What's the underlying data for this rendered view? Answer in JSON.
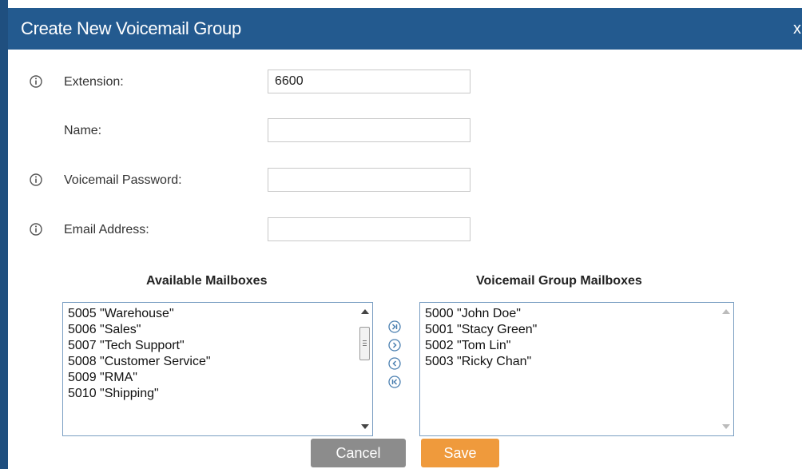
{
  "dialog": {
    "title": "Create New Voicemail Group",
    "close_label": "x"
  },
  "colors": {
    "header": "#235a8f",
    "save_button": "#ef9a3c",
    "cancel_button": "#8c8c8c",
    "list_border": "#7a9ec2"
  },
  "form": {
    "extension": {
      "label": "Extension:",
      "value": "6600",
      "info_icon": "info-circle-icon"
    },
    "name": {
      "label": "Name:",
      "value": ""
    },
    "voicemail_password": {
      "label": "Voicemail Password:",
      "value": "",
      "info_icon": "info-circle-icon"
    },
    "email_address": {
      "label": "Email Address:",
      "value": "",
      "info_icon": "info-circle-icon"
    }
  },
  "available_mailboxes": {
    "title": "Available Mailboxes",
    "items": [
      "5005 \"Warehouse\"",
      "5006 \"Sales\"",
      "5007 \"Tech Support\"",
      "5008 \"Customer Service\"",
      "5009 \"RMA\"",
      "5010 \"Shipping\""
    ]
  },
  "group_mailboxes": {
    "title": "Voicemail Group Mailboxes",
    "items": [
      "5000 \"John Doe\"",
      "5001 \"Stacy Green\"",
      "5002 \"Tom Lin\"",
      "5003 \"Ricky Chan\""
    ]
  },
  "transfer_buttons": [
    {
      "name": "move-all-right-icon"
    },
    {
      "name": "move-right-icon"
    },
    {
      "name": "move-left-icon"
    },
    {
      "name": "move-all-left-icon"
    }
  ],
  "footer": {
    "cancel_label": "Cancel",
    "save_label": "Save"
  }
}
